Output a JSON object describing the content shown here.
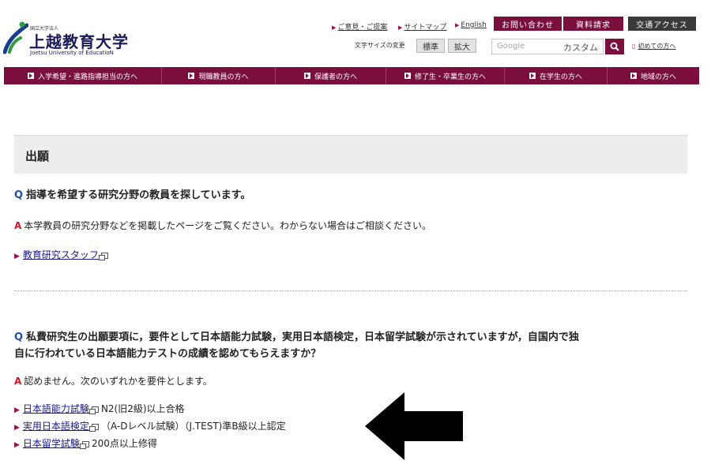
{
  "header": {
    "logo_small": "国立大学法人",
    "logo_main": "上越教育大学",
    "logo_en": "Joetsu University of EducatioN",
    "top_links": [
      "ご意見・ご提案",
      "サイトマップ",
      "English"
    ],
    "contact_btn": "お問い合わせ",
    "request_btn": "資料請求",
    "access_btn": "交通アクセス",
    "fontsize_label": "文字サイズの変更",
    "fontsize_standard": "標準",
    "fontsize_large": "拡大",
    "search_placeholder": "Google",
    "search_custom": "カスタム",
    "first_visit": "初めての方へ"
  },
  "nav": [
    "入学希望・進路指導担当の方へ",
    "現職教員の方へ",
    "保護者の方へ",
    "修了生・卒業生の方へ",
    "在学生の方へ",
    "地域の方へ"
  ],
  "page": {
    "title": "出願",
    "faq1": {
      "q_mark": "Q",
      "question": "指導を希望する研究分野の教員を探しています。",
      "a_mark": "A",
      "answer": "本学教員の研究分野などを掲載したページをご覧ください。わからない場合はご相談ください。",
      "link": "教育研究スタッフ"
    },
    "faq2": {
      "q_mark": "Q",
      "question_line1": "私費研究生の出願要項に，要件として日本語能力試験，実用日本語検定，日本留学試験が示されていますが，自国内で独",
      "question_line2": "自に行われている日本語能力テストの成績を認めてもらえますか？",
      "a_mark": "A",
      "answer": "認めません。次のいずれかを要件とします。",
      "items": [
        {
          "link": "日本語能力試験",
          "text": "N2(旧2級)以上合格"
        },
        {
          "link": "実用日本語検定",
          "text": "（A-Dレベル試験）（J.TEST)準B級以上認定"
        },
        {
          "link": "日本留学試験",
          "text": "200点以上修得"
        }
      ]
    }
  },
  "colors": {
    "brand": "#7a0f3e",
    "question_mark": "#1f4fa8",
    "answer_mark": "#d8101e",
    "arrow": "#000000"
  }
}
